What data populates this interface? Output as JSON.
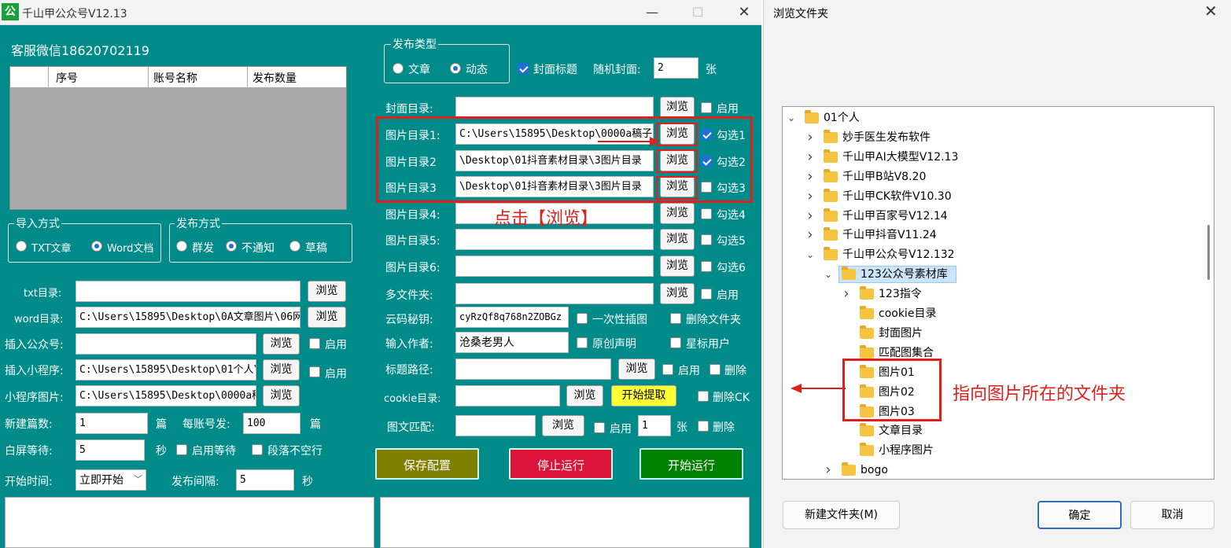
{
  "app": {
    "icon_text": "公",
    "title": "千山甲公众号V12.13",
    "minimize": "—",
    "maximize": "☐",
    "close": "✕"
  },
  "service": "客服微信18620702119",
  "grid": {
    "headers": [
      "序号",
      "账号名称",
      "发布数量"
    ]
  },
  "import_group": {
    "label": "导入方式",
    "options": [
      "TXT文章",
      "Word文档"
    ],
    "selected": 1
  },
  "publish_method_group": {
    "label": "发布方式",
    "options": [
      "群发",
      "不通知",
      "草稿"
    ],
    "selected": 1
  },
  "left_form": {
    "txt_dir_label": "txt目录:",
    "txt_dir_value": "",
    "txt_browse": "浏览",
    "word_dir_label": "word目录:",
    "word_dir_value": "C:\\Users\\15895\\Desktop\\0A文章图片\\06网",
    "word_browse": "浏览",
    "insert_gzh_label": "插入公众号:",
    "insert_gzh_value": "",
    "insert_gzh_browse": "浏览",
    "insert_gzh_enable": "启用",
    "insert_mini_label": "插入小程序:",
    "insert_mini_value": "C:\\Users\\15895\\Desktop\\01个人\\",
    "insert_mini_browse": "浏览",
    "insert_mini_enable": "启用",
    "mini_img_label": "小程序图片:",
    "mini_img_value": "C:\\Users\\15895\\Desktop\\0000a稿",
    "mini_img_browse": "浏览",
    "new_count_label": "新建篇数:",
    "new_count_value": "1",
    "new_count_unit": "篇",
    "per_account_label": "每账号发:",
    "per_account_value": "100",
    "per_account_unit": "篇",
    "white_wait_label": "白屏等待:",
    "white_wait_value": "5",
    "white_wait_unit": "秒",
    "enable_wait": "启用等待",
    "no_blank_para": "段落不空行",
    "start_time_label": "开始时间:",
    "start_time_value": "立即开始",
    "interval_label": "发布间隔:",
    "interval_value": "5",
    "interval_unit": "秒"
  },
  "publish_type": {
    "label": "发布类型",
    "options": [
      "文章",
      "动态"
    ],
    "selected": 1
  },
  "cover_title": "封面标题",
  "random_cover_label": "随机封面:",
  "random_cover_value": "2",
  "random_cover_unit": "张",
  "right_rows": [
    {
      "label": "封面目录:",
      "value": "",
      "browse": "浏览",
      "check": "启用",
      "checked": false
    },
    {
      "label": "图片目录1:",
      "value": "C:\\Users\\15895\\Desktop\\0000a稿子\\",
      "browse": "浏览",
      "check": "勾选1",
      "checked": true
    },
    {
      "label": "图片目录2",
      "value": "\\Desktop\\01抖音素材目录\\3图片目录",
      "browse": "浏览",
      "check": "勾选2",
      "checked": true
    },
    {
      "label": "图片目录3",
      "value": "\\Desktop\\01抖音素材目录\\3图片目录",
      "browse": "浏览",
      "check": "勾选3",
      "checked": false
    },
    {
      "label": "图片目录4:",
      "value": "",
      "browse": "浏览",
      "check": "勾选4",
      "checked": false
    },
    {
      "label": "图片目录5:",
      "value": "",
      "browse": "浏览",
      "check": "勾选5",
      "checked": false
    },
    {
      "label": "图片目录6:",
      "value": "",
      "browse": "浏览",
      "check": "勾选6",
      "checked": false
    },
    {
      "label": "多文件夹:",
      "value": "",
      "browse": "浏览",
      "check": "启用",
      "checked": false
    }
  ],
  "cloud_key_label": "云码秘钥:",
  "cloud_key_value": "cyRzQf8q768n2ZOBGz",
  "once_insert": "一次性插图",
  "delete_folder": "删除文件夹",
  "author_label": "输入作者:",
  "author_value": "沧桑老男人",
  "original": "原创声明",
  "star_user": "星标用户",
  "title_path_label": "标题路径:",
  "title_path_browse": "浏览",
  "title_path_enable": "启用",
  "title_path_delete": "删除",
  "cookie_label": "cookie目录:",
  "cookie_browse": "浏览",
  "cookie_start": "开始提取",
  "cookie_delete": "删除CK",
  "match_label": "图文匹配:",
  "match_browse": "浏览",
  "match_enable": "启用",
  "match_value": "1",
  "match_unit": "张",
  "match_delete": "删除",
  "save_btn": "保存配置",
  "stop_btn": "停止运行",
  "start_btn": "开始运行",
  "annot_click": "点击【浏览】",
  "annot_folder": "指向图片所在的文件夹",
  "dialog": {
    "title": "浏览文件夹",
    "close": "✕",
    "tree": [
      {
        "text": "01个人",
        "level": 0,
        "chev": "open"
      },
      {
        "text": "妙手医生发布软件",
        "level": 1,
        "chev": "closed"
      },
      {
        "text": "千山甲AI大模型V12.13",
        "level": 1,
        "chev": "closed"
      },
      {
        "text": "千山甲B站V8.20",
        "level": 1,
        "chev": "closed"
      },
      {
        "text": "千山甲CK软件V10.30",
        "level": 1,
        "chev": "closed"
      },
      {
        "text": "千山甲百家号V12.14",
        "level": 1,
        "chev": "closed"
      },
      {
        "text": "千山甲抖音V11.24",
        "level": 1,
        "chev": "closed"
      },
      {
        "text": "千山甲公众号V12.132",
        "level": 1,
        "chev": "open"
      },
      {
        "text": "123公众号素材库",
        "level": 2,
        "chev": "open",
        "selected": true
      },
      {
        "text": "123指令",
        "level": 3,
        "chev": "closed"
      },
      {
        "text": "cookie目录",
        "level": 3,
        "chev": ""
      },
      {
        "text": "封面图片",
        "level": 3,
        "chev": ""
      },
      {
        "text": "匹配图集合",
        "level": 3,
        "chev": ""
      },
      {
        "text": "图片01",
        "level": 3,
        "chev": ""
      },
      {
        "text": "图片02",
        "level": 3,
        "chev": ""
      },
      {
        "text": "图片03",
        "level": 3,
        "chev": ""
      },
      {
        "text": "文章目录",
        "level": 3,
        "chev": ""
      },
      {
        "text": "小程序图片",
        "level": 3,
        "chev": ""
      },
      {
        "text": "bogo",
        "level": 2,
        "chev": "closed"
      }
    ],
    "new_folder": "新建文件夹(M)",
    "ok": "确定",
    "cancel": "取消"
  }
}
